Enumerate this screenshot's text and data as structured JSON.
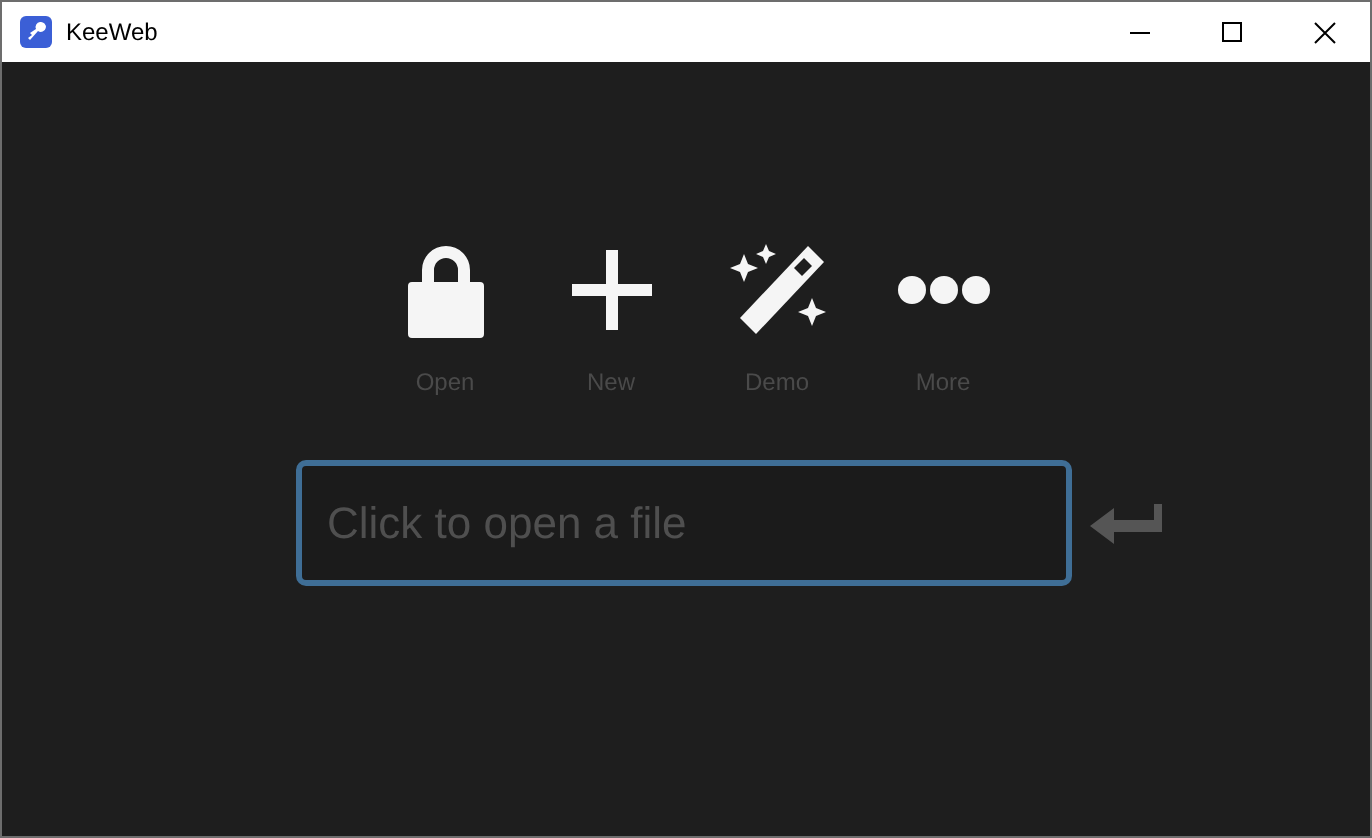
{
  "window": {
    "title": "KeeWeb"
  },
  "actions": [
    {
      "kind": "open",
      "label": "Open"
    },
    {
      "kind": "new",
      "label": "New"
    },
    {
      "kind": "demo",
      "label": "Demo"
    },
    {
      "kind": "more",
      "label": "More"
    }
  ],
  "file_field": {
    "placeholder": "Click to open a file"
  }
}
